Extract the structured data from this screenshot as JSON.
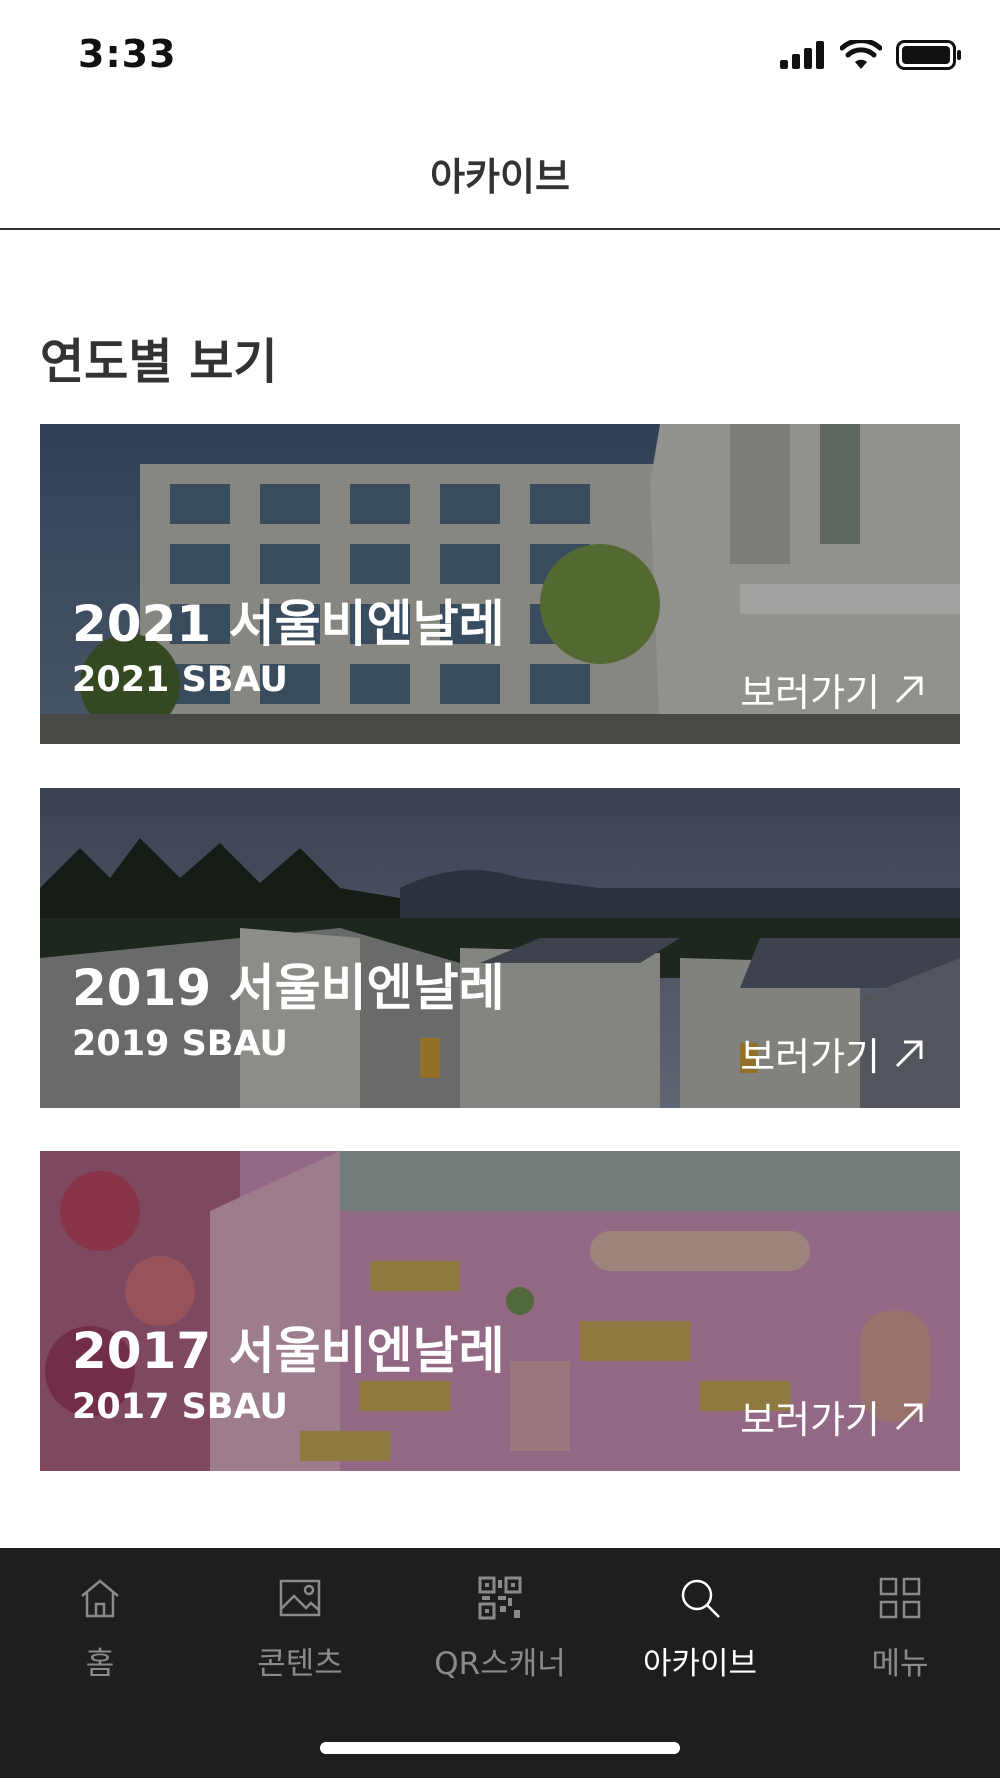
{
  "status": {
    "time": "3:33",
    "icons": [
      "signal-icon",
      "wifi-icon",
      "battery-icon"
    ]
  },
  "header": {
    "title": "아카이브"
  },
  "section": {
    "title": "연도별 보기"
  },
  "cards": [
    {
      "title": "2021 서울비엔날레",
      "subtitle": "2021 SBAU",
      "link": "보러가기",
      "icon": "arrow-up-right-icon"
    },
    {
      "title": "2019 서울비엔날레",
      "subtitle": "2019 SBAU",
      "link": "보러가기",
      "icon": "arrow-up-right-icon"
    },
    {
      "title": "2017 서울비엔날레",
      "subtitle": "2017 SBAU",
      "link": "보러가기",
      "icon": "arrow-up-right-icon"
    }
  ],
  "tabbar": {
    "active": "아카이브",
    "items": [
      {
        "label": "홈",
        "icon": "home-icon"
      },
      {
        "label": "콘텐츠",
        "icon": "image-icon"
      },
      {
        "label": "QR스캐너",
        "icon": "qr-code-icon"
      },
      {
        "label": "아카이브",
        "icon": "search-icon"
      },
      {
        "label": "메뉴",
        "icon": "grid-menu-icon"
      }
    ]
  },
  "colors": {
    "tabbar_bg": "#1e1e1e",
    "active_tab": "#ffffff",
    "inactive_tab": "#8a8a8a",
    "text_dark": "#333333"
  }
}
